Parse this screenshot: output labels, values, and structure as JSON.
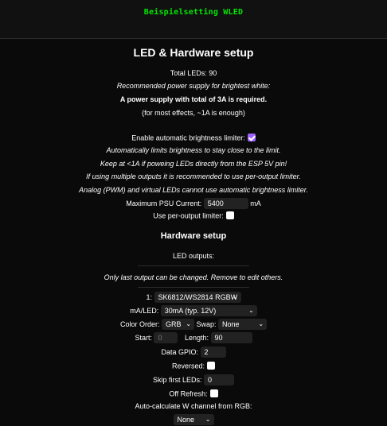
{
  "header": {
    "title": "Beispielsetting WLED"
  },
  "section": {
    "title": "LED & Hardware setup",
    "total_leds": "Total LEDs: 90",
    "recommended": "Recommended power supply for brightest white:",
    "psu_required": "A power supply with total of 3A is required.",
    "most_effects": "(for most effects, ~1A is enough)",
    "abl_label": "Enable automatic brightness limiter:",
    "abl_checked": true,
    "abl_note1": "Automatically limits brightness to stay close to the limit.",
    "abl_note2": "Keep at <1A if poweing LEDs directly from the ESP 5V pin!",
    "abl_note3": "If using multiple outputs it is recommended to use per-output limiter.",
    "abl_note4": "Analog (PWM) and virtual LEDs cannot use automatic brightness limiter.",
    "max_psu_label": "Maximum PSU Current:",
    "max_psu_value": "5400",
    "max_psu_unit": "mA",
    "per_output_label": "Use per-output limiter:",
    "per_output_checked": false
  },
  "hardware": {
    "title": "Hardware setup",
    "led_outputs": "LED outputs:",
    "note": "Only last output can be changed. Remove to edit others.",
    "output_index": "1:",
    "led_type": "SK6812/WS2814 RGBW",
    "ma_led_label": "mA/LED:",
    "ma_led_value": "30mA (typ. 12V)",
    "color_order_label": "Color Order:",
    "color_order_value": "GRB",
    "swap_label": "Swap:",
    "swap_value": "None",
    "start_label": "Start:",
    "start_value": "0",
    "length_label": "Length:",
    "length_value": "90",
    "gpio_label": "Data GPIO:",
    "gpio_value": "2",
    "reversed_label": "Reversed:",
    "reversed_checked": false,
    "skip_label": "Skip first LEDs:",
    "skip_value": "0",
    "off_refresh_label": "Off Refresh:",
    "off_refresh_checked": false,
    "auto_w_label": "Auto-calculate W channel from RGB:",
    "auto_w_value": "None"
  },
  "colors": {
    "accent": "#00e600",
    "checkbox_on": "#9f62ff",
    "background": "#0a0a0a",
    "field": "#222222"
  },
  "icons": {
    "dropdown": "chevron-down-icon",
    "check": "checkmark-icon"
  }
}
